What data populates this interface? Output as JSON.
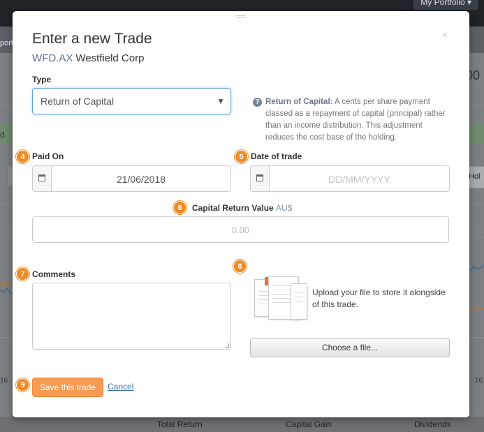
{
  "background": {
    "portfolio_menu": "My Portfolio ▾",
    "nav_fragment": "port",
    "notice_fragment": "d.",
    "big_number_fragment": "00",
    "hol_button": "Hol",
    "axis_label_left": "16",
    "axis_label_right": "16",
    "footer_columns": [
      "Total Return",
      "Capital Gain",
      "Dividends"
    ]
  },
  "modal": {
    "title": "Enter a new Trade",
    "ticker": "WFD.AX",
    "company": "Westfield Corp",
    "close_glyph": "×",
    "type": {
      "label": "Type",
      "selected": "Return of Capital",
      "caret": "▼"
    },
    "help": {
      "icon": "question-circle-icon",
      "heading": "Return of Capital:",
      "body": " A cents per share payment classed as a repayment of capital (principal) rather than an income distribution. This adjustment reduces the cost base of the holding."
    },
    "paid_on": {
      "badge": "4",
      "label": "Paid On",
      "value": "21/06/2018"
    },
    "date_of_trade": {
      "badge": "5",
      "label": "Date of trade",
      "placeholder": "DD/MM/YYYY"
    },
    "capital_return": {
      "badge": "6",
      "label": "Capital Return Value",
      "currency": "AU$",
      "placeholder": "0.00"
    },
    "comments": {
      "badge": "7",
      "label": "Comments",
      "value": ""
    },
    "upload": {
      "badge": "8",
      "text": "Upload your file to store it alongside of this trade.",
      "button": "Choose a file..."
    },
    "actions": {
      "badge": "9",
      "save": "Save this trade",
      "cancel": "Cancel"
    }
  },
  "colors": {
    "accent_orange": "#f08a24",
    "save_button": "#f79a52",
    "link_blue": "#3a6ea5",
    "ticker_blue": "#5a6e8c"
  }
}
